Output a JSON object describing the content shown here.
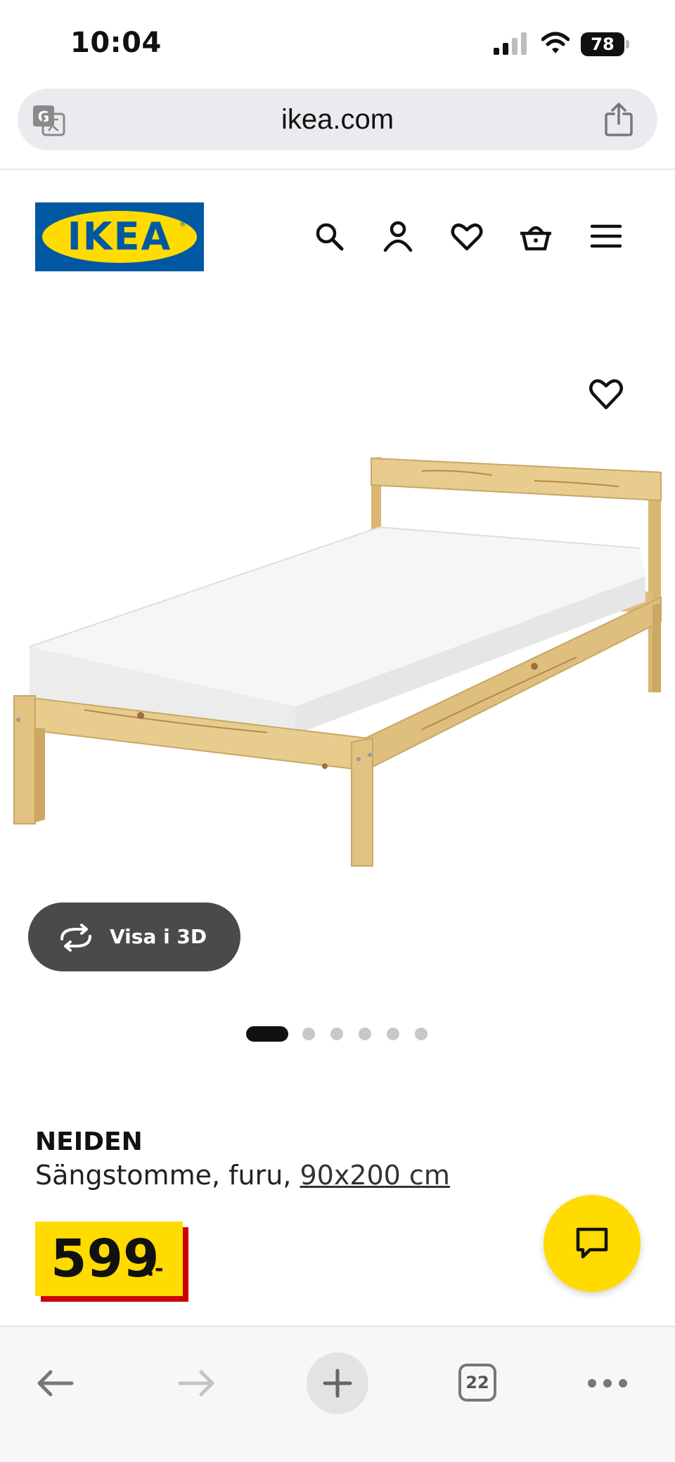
{
  "status_bar": {
    "time": "10:04",
    "battery": "78"
  },
  "browser": {
    "url": "ikea.com",
    "tabs_count": "22"
  },
  "header": {
    "logo_text": "IKEA",
    "icons": [
      "search-icon",
      "account-icon",
      "heart-icon",
      "basket-icon",
      "menu-icon"
    ]
  },
  "product": {
    "view3d_label": "Visa i 3D",
    "carousel": {
      "total": 6,
      "active": 1
    },
    "name": "NEIDEN",
    "description": "Sängstomme, furu,",
    "size": "90x200 cm",
    "price": "599",
    "price_suffix": ":-"
  },
  "colors": {
    "ikea_blue": "#0058a3",
    "ikea_yellow": "#ffdb00",
    "price_red": "#cc0008",
    "pine_wood": "#e8cc8e",
    "dark_pill": "#4a4a4a"
  }
}
